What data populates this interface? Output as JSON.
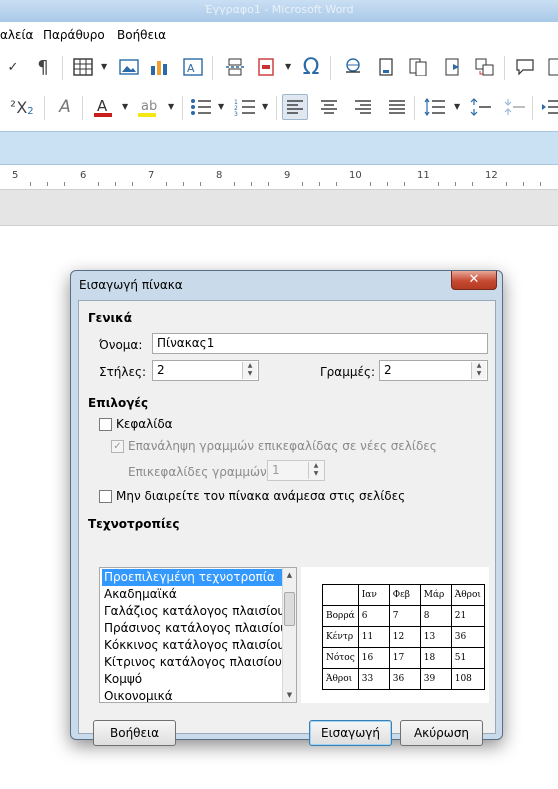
{
  "window": {
    "title": "Έγγραφο1 - Microsoft Word"
  },
  "menubar": {
    "items": [
      "αλεία",
      "Παράθυρο",
      "Βοήθεια"
    ]
  },
  "ruler": {
    "numbers": [
      "5",
      "6",
      "7",
      "8",
      "9",
      "10",
      "11",
      "12"
    ]
  },
  "dialog": {
    "title": "Εισαγωγή πίνακα",
    "close_label": "✕",
    "general": {
      "heading": "Γενικά",
      "name_label": "Όνομα:",
      "name_value": "Πίνακας1",
      "columns_label": "Στήλες:",
      "columns_value": "2",
      "rows_label": "Γραμμές:",
      "rows_value": "2"
    },
    "options": {
      "heading": "Επιλογές",
      "header_label": "Κεφαλίδα",
      "repeat_label": "Επανάληψη γραμμών επικεφαλίδας σε νέες σελίδες",
      "heading_rows_label": "Επικεφαλίδες γραμμών:",
      "heading_rows_value": "1",
      "dont_split_label": "Μην διαιρείτε τον πίνακα ανάμεσα στις σελίδες"
    },
    "styles": {
      "heading": "Τεχνοτροπίες",
      "items": [
        "Προεπιλεγμένη τεχνοτροπία",
        "Ακαδημαϊκά",
        "Γαλάζιος κατάλογος πλαισίου",
        "Πράσινος κατάλογος πλαισίου",
        "Κόκκινος κατάλογος πλαισίου",
        "Κίτρινος κατάλογος πλαισίου",
        "Κομψό",
        "Οικονομικά"
      ],
      "selected_index": 0
    },
    "preview": {
      "rows": [
        [
          "",
          "Ιαν",
          "Φεβ",
          "Μάρ",
          "Άθροι"
        ],
        [
          "Βορρά",
          "6",
          "7",
          "8",
          "21"
        ],
        [
          "Κέντρ",
          "11",
          "12",
          "13",
          "36"
        ],
        [
          "Νότος",
          "16",
          "17",
          "18",
          "51"
        ],
        [
          "Άθροι",
          "33",
          "36",
          "39",
          "108"
        ]
      ]
    },
    "buttons": {
      "help": "Βοήθεια",
      "insert": "Εισαγωγή",
      "cancel": "Ακύρωση"
    }
  }
}
